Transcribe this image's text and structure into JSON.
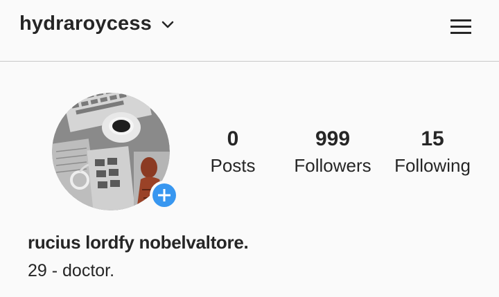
{
  "header": {
    "username": "hydraroycess",
    "dropdown_icon": "chevron-down-icon",
    "menu_icon": "hamburger-menu-icon"
  },
  "profile": {
    "avatar_alt": "profile photo",
    "add_story_icon": "plus-icon",
    "accent_color": "#3897f0",
    "stats": [
      {
        "value": "0",
        "label": "Posts"
      },
      {
        "value": "999",
        "label": "Followers"
      },
      {
        "value": "15",
        "label": "Following"
      }
    ],
    "full_name": "rucius lordfy nobelvaltore.",
    "bio": "29 - doctor."
  }
}
